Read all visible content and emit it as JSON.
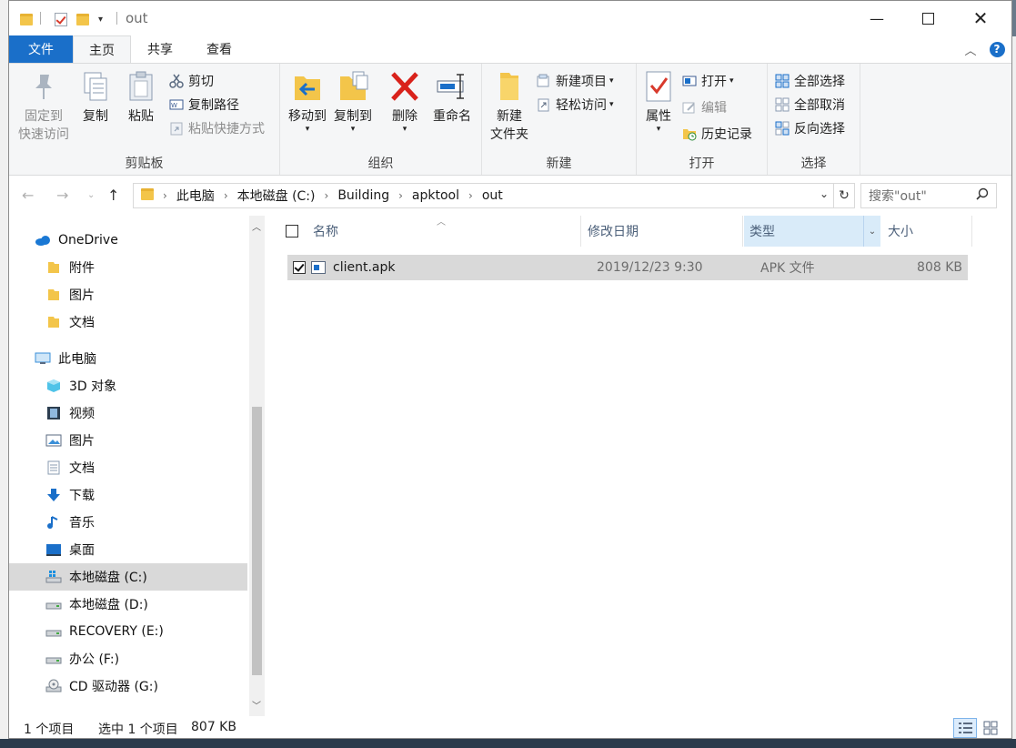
{
  "window": {
    "title": "out",
    "tabs": {
      "file": "文件",
      "home": "主页",
      "share": "共享",
      "view": "查看"
    }
  },
  "ribbon": {
    "clipboard": {
      "label": "剪贴板",
      "pin": "固定到\n快速访问",
      "pin_l1": "固定到",
      "pin_l2": "快速访问",
      "copy": "复制",
      "paste": "粘贴",
      "cut": "剪切",
      "copy_path": "复制路径",
      "paste_shortcut": "粘贴快捷方式"
    },
    "organize": {
      "label": "组织",
      "move_to": "移动到",
      "copy_to": "复制到",
      "delete": "删除",
      "rename": "重命名"
    },
    "new": {
      "label": "新建",
      "new_folder_l1": "新建",
      "new_folder_l2": "文件夹",
      "new_item": "新建项目",
      "easy_access": "轻松访问"
    },
    "open": {
      "label": "打开",
      "properties": "属性",
      "open": "打开",
      "edit": "编辑",
      "history": "历史记录"
    },
    "select": {
      "label": "选择",
      "select_all": "全部选择",
      "select_none": "全部取消",
      "invert": "反向选择"
    }
  },
  "address": {
    "crumbs": [
      "此电脑",
      "本地磁盘 (C:)",
      "Building",
      "apktool",
      "out"
    ],
    "search_placeholder": "搜索\"out\""
  },
  "sidebar": {
    "items": [
      {
        "label": "OneDrive",
        "icon": "cloud-icon"
      },
      {
        "label": "附件",
        "icon": "folder-icon"
      },
      {
        "label": "图片",
        "icon": "folder-icon"
      },
      {
        "label": "文档",
        "icon": "folder-icon"
      },
      {
        "label": "此电脑",
        "icon": "computer-icon"
      },
      {
        "label": "3D 对象",
        "icon": "cube-icon"
      },
      {
        "label": "视频",
        "icon": "video-icon"
      },
      {
        "label": "图片",
        "icon": "pictures-icon"
      },
      {
        "label": "文档",
        "icon": "documents-icon"
      },
      {
        "label": "下载",
        "icon": "download-icon"
      },
      {
        "label": "音乐",
        "icon": "music-icon"
      },
      {
        "label": "桌面",
        "icon": "desktop-icon"
      },
      {
        "label": "本地磁盘 (C:)",
        "icon": "windows-drive-icon"
      },
      {
        "label": "本地磁盘 (D:)",
        "icon": "drive-icon"
      },
      {
        "label": "RECOVERY (E:)",
        "icon": "drive-icon"
      },
      {
        "label": "办公 (F:)",
        "icon": "drive-icon"
      },
      {
        "label": "CD 驱动器 (G:)",
        "icon": "cd-drive-icon"
      }
    ]
  },
  "columns": {
    "name": "名称",
    "modified": "修改日期",
    "type": "类型",
    "size": "大小"
  },
  "files": [
    {
      "name": "client.apk",
      "modified": "2019/12/23 9:30",
      "type": "APK 文件",
      "size": "808 KB"
    }
  ],
  "status": {
    "count": "1 个项目",
    "selected": "选中 1 个项目",
    "selected_size": "807 KB"
  },
  "colors": {
    "accent": "#1a6fc9",
    "selection": "#d9d9d9",
    "header_text": "#4c607a"
  }
}
